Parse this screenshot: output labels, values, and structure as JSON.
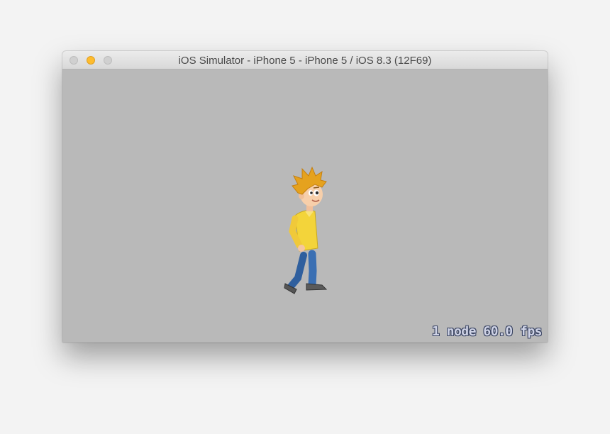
{
  "window": {
    "title": "iOS Simulator - iPhone 5 - iPhone 5 / iOS 8.3 (12F69)",
    "controls": [
      "close",
      "minimize",
      "zoom"
    ]
  },
  "scene": {
    "background_color": "#b9b9b9",
    "sprite": "walking-boy-character",
    "stats_text": "1 node 60.0 fps"
  }
}
